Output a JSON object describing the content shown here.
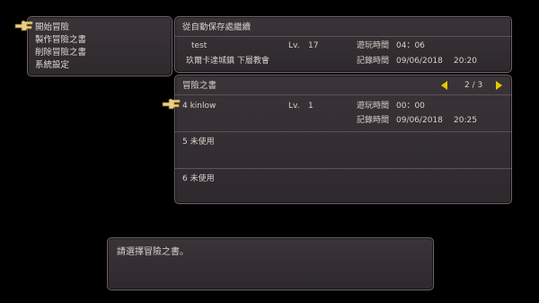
{
  "main_menu": {
    "items": [
      {
        "label": "開始冒險"
      },
      {
        "label": "製作冒險之書"
      },
      {
        "label": "削除冒險之書"
      },
      {
        "label": "系統設定"
      }
    ]
  },
  "autosave": {
    "title": "從自動保存處繼續",
    "name": "test",
    "level_label": "Lv.",
    "level": "17",
    "playtime_label": "遊玩時間",
    "playtime": "04：06",
    "location": "玖爾卡達城鎮 下層教會",
    "record_label": "記錄時間",
    "record_date": "09/06/2018",
    "record_time": "20:20"
  },
  "books": {
    "title": "冒險之書",
    "page": "2 / 3",
    "slots": [
      {
        "label": "4 kinlow",
        "level_label": "Lv.",
        "level": "1",
        "playtime_label": "遊玩時間",
        "playtime": "00：00",
        "record_label": "記錄時間",
        "record_date": "09/06/2018",
        "record_time": "20:25"
      },
      {
        "label": "5 未使用"
      },
      {
        "label": "6 未使用"
      }
    ]
  },
  "message": {
    "text": "請選擇冒險之書。"
  },
  "icons": {
    "pointer": "hand-pointer-icon",
    "prev": "arrow-left-icon",
    "next": "arrow-right-icon"
  },
  "colors": {
    "arrow": "#e8c800",
    "pointer": "#e9cf86"
  }
}
